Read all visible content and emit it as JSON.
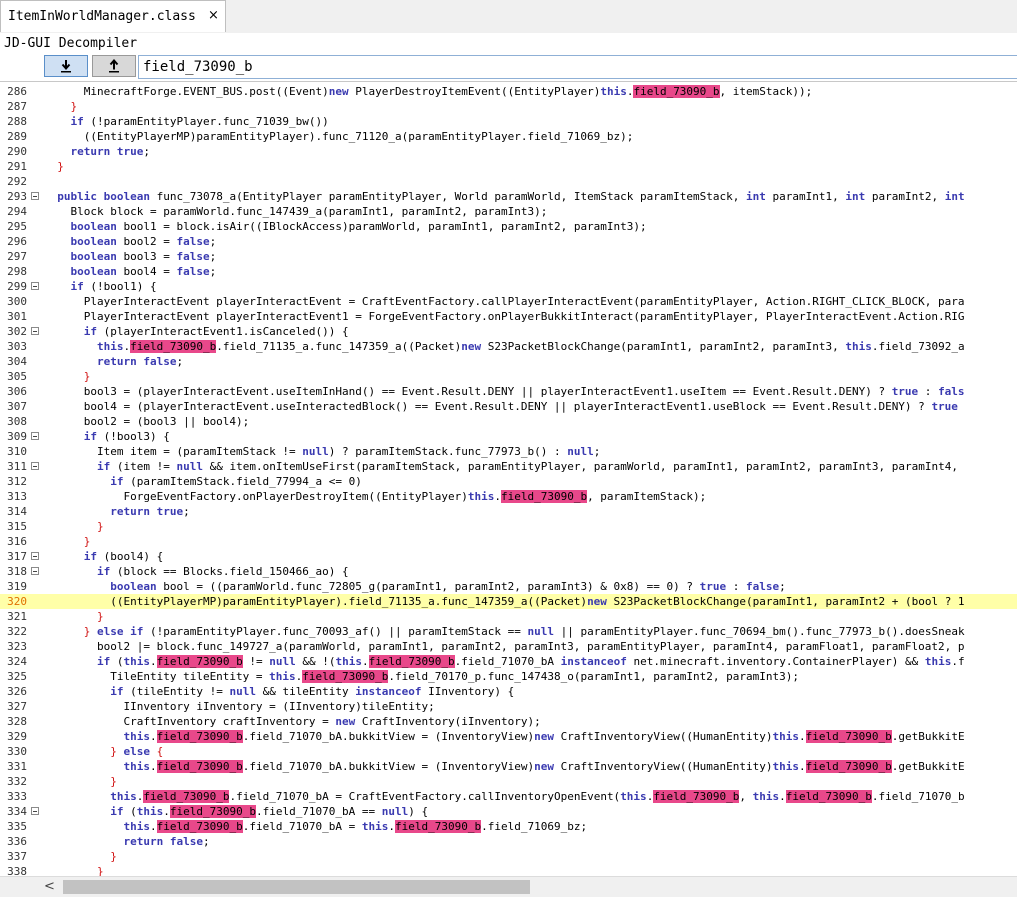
{
  "tab": {
    "label": "ItemInWorldManager.class",
    "close": "×"
  },
  "app_title": "JD-GUI Decompiler",
  "search": {
    "value": "field_73090_b",
    "down_icon": "arrow-down-icon",
    "up_icon": "arrow-up-icon"
  },
  "highlight_color": "#e8488a",
  "current_line_color": "#ffffa8",
  "current_line": 320,
  "scrollbar": {
    "left_arrow": "<"
  },
  "lines": [
    {
      "n": 286,
      "fold": false,
      "segs": [
        [
          "      MinecraftForge.EVENT_BUS.post((Event)",
          ""
        ],
        [
          "new",
          "k"
        ],
        [
          " PlayerDestroyItemEvent((EntityPlayer)",
          ""
        ],
        [
          "this",
          "k"
        ],
        [
          ".",
          ""
        ],
        [
          "field_73090_b",
          "h"
        ],
        [
          ", itemStack));",
          ""
        ]
      ]
    },
    {
      "n": 287,
      "fold": false,
      "segs": [
        [
          "    }",
          "r"
        ]
      ]
    },
    {
      "n": 288,
      "fold": false,
      "segs": [
        [
          "    ",
          ""
        ],
        [
          "if",
          "k"
        ],
        [
          " (!paramEntityPlayer.func_71039_bw())",
          ""
        ]
      ]
    },
    {
      "n": 289,
      "fold": false,
      "segs": [
        [
          "      ((EntityPlayerMP)paramEntityPlayer).func_71120_a(paramEntityPlayer.field_71069_bz);",
          ""
        ]
      ]
    },
    {
      "n": 290,
      "fold": false,
      "segs": [
        [
          "    ",
          ""
        ],
        [
          "return",
          "k"
        ],
        [
          " ",
          ""
        ],
        [
          "true",
          "k"
        ],
        [
          ";",
          ""
        ]
      ]
    },
    {
      "n": 291,
      "fold": false,
      "segs": [
        [
          "  }",
          "r"
        ]
      ]
    },
    {
      "n": 292,
      "fold": false,
      "segs": [
        [
          "",
          ""
        ]
      ]
    },
    {
      "n": 293,
      "fold": true,
      "segs": [
        [
          "  ",
          ""
        ],
        [
          "public",
          "k"
        ],
        [
          " ",
          ""
        ],
        [
          "boolean",
          "k"
        ],
        [
          " func_73078_a(EntityPlayer paramEntityPlayer, World paramWorld, ItemStack paramItemStack, ",
          ""
        ],
        [
          "int",
          "k"
        ],
        [
          " paramInt1, ",
          ""
        ],
        [
          "int",
          "k"
        ],
        [
          " paramInt2, ",
          ""
        ],
        [
          "int",
          "k"
        ]
      ]
    },
    {
      "n": 294,
      "fold": false,
      "segs": [
        [
          "    Block block = paramWorld.func_147439_a(paramInt1, paramInt2, paramInt3);",
          ""
        ]
      ]
    },
    {
      "n": 295,
      "fold": false,
      "segs": [
        [
          "    ",
          ""
        ],
        [
          "boolean",
          "k"
        ],
        [
          " bool1 = block.isAir((IBlockAccess)paramWorld, paramInt1, paramInt2, paramInt3);",
          ""
        ]
      ]
    },
    {
      "n": 296,
      "fold": false,
      "segs": [
        [
          "    ",
          ""
        ],
        [
          "boolean",
          "k"
        ],
        [
          " bool2 = ",
          ""
        ],
        [
          "false",
          "k"
        ],
        [
          ";",
          ""
        ]
      ]
    },
    {
      "n": 297,
      "fold": false,
      "segs": [
        [
          "    ",
          ""
        ],
        [
          "boolean",
          "k"
        ],
        [
          " bool3 = ",
          ""
        ],
        [
          "false",
          "k"
        ],
        [
          ";",
          ""
        ]
      ]
    },
    {
      "n": 298,
      "fold": false,
      "segs": [
        [
          "    ",
          ""
        ],
        [
          "boolean",
          "k"
        ],
        [
          " bool4 = ",
          ""
        ],
        [
          "false",
          "k"
        ],
        [
          ";",
          ""
        ]
      ]
    },
    {
      "n": 299,
      "fold": true,
      "segs": [
        [
          "    ",
          ""
        ],
        [
          "if",
          "k"
        ],
        [
          " (!bool1) {",
          ""
        ]
      ]
    },
    {
      "n": 300,
      "fold": false,
      "segs": [
        [
          "      PlayerInteractEvent playerInteractEvent = CraftEventFactory.callPlayerInteractEvent(paramEntityPlayer, Action.RIGHT_CLICK_BLOCK, para",
          ""
        ]
      ]
    },
    {
      "n": 301,
      "fold": false,
      "segs": [
        [
          "      PlayerInteractEvent playerInteractEvent1 = ForgeEventFactory.onPlayerBukkitInteract(paramEntityPlayer, PlayerInteractEvent.Action.RIG",
          ""
        ]
      ]
    },
    {
      "n": 302,
      "fold": true,
      "segs": [
        [
          "      ",
          ""
        ],
        [
          "if",
          "k"
        ],
        [
          " (playerInteractEvent1.isCanceled()) {",
          ""
        ]
      ]
    },
    {
      "n": 303,
      "fold": false,
      "segs": [
        [
          "        ",
          ""
        ],
        [
          "this",
          "k"
        ],
        [
          ".",
          ""
        ],
        [
          "field_73090_b",
          "h"
        ],
        [
          ".field_71135_a.func_147359_a((Packet)",
          ""
        ],
        [
          "new",
          "k"
        ],
        [
          " S23PacketBlockChange(paramInt1, paramInt2, paramInt3, ",
          ""
        ],
        [
          "this",
          "k"
        ],
        [
          ".field_73092_a",
          ""
        ]
      ]
    },
    {
      "n": 304,
      "fold": false,
      "segs": [
        [
          "        ",
          ""
        ],
        [
          "return",
          "k"
        ],
        [
          " ",
          ""
        ],
        [
          "false",
          "k"
        ],
        [
          ";",
          ""
        ]
      ]
    },
    {
      "n": 305,
      "fold": false,
      "segs": [
        [
          "      }",
          "r"
        ]
      ]
    },
    {
      "n": 306,
      "fold": false,
      "segs": [
        [
          "      bool3 = (playerInteractEvent.useItemInHand() == Event.Result.DENY || playerInteractEvent1.useItem == Event.Result.DENY) ? ",
          ""
        ],
        [
          "true",
          "k"
        ],
        [
          " : ",
          ""
        ],
        [
          "fals",
          "k"
        ]
      ]
    },
    {
      "n": 307,
      "fold": false,
      "segs": [
        [
          "      bool4 = (playerInteractEvent.useInteractedBlock() == Event.Result.DENY || playerInteractEvent1.useBlock == Event.Result.DENY) ? ",
          ""
        ],
        [
          "true",
          "k"
        ]
      ]
    },
    {
      "n": 308,
      "fold": false,
      "segs": [
        [
          "      bool2 = (bool3 || bool4);",
          ""
        ]
      ]
    },
    {
      "n": 309,
      "fold": true,
      "segs": [
        [
          "      ",
          ""
        ],
        [
          "if",
          "k"
        ],
        [
          " (!bool3) {",
          ""
        ]
      ]
    },
    {
      "n": 310,
      "fold": false,
      "segs": [
        [
          "        Item item = (paramItemStack != ",
          ""
        ],
        [
          "null",
          "k"
        ],
        [
          ") ? paramItemStack.func_77973_b() : ",
          ""
        ],
        [
          "null",
          "k"
        ],
        [
          ";",
          ""
        ]
      ]
    },
    {
      "n": 311,
      "fold": true,
      "segs": [
        [
          "        ",
          ""
        ],
        [
          "if",
          "k"
        ],
        [
          " (item != ",
          ""
        ],
        [
          "null",
          "k"
        ],
        [
          " && item.onItemUseFirst(paramItemStack, paramEntityPlayer, paramWorld, paramInt1, paramInt2, paramInt3, paramInt4,",
          ""
        ]
      ]
    },
    {
      "n": 312,
      "fold": false,
      "segs": [
        [
          "          ",
          ""
        ],
        [
          "if",
          "k"
        ],
        [
          " (paramItemStack.field_77994_a <= 0)",
          ""
        ]
      ]
    },
    {
      "n": 313,
      "fold": false,
      "segs": [
        [
          "            ForgeEventFactory.onPlayerDestroyItem((EntityPlayer)",
          ""
        ],
        [
          "this",
          "k"
        ],
        [
          ".",
          ""
        ],
        [
          "field_73090_b",
          "h"
        ],
        [
          ", paramItemStack);",
          ""
        ]
      ]
    },
    {
      "n": 314,
      "fold": false,
      "segs": [
        [
          "          ",
          ""
        ],
        [
          "return",
          "k"
        ],
        [
          " ",
          ""
        ],
        [
          "true",
          "k"
        ],
        [
          ";",
          ""
        ]
      ]
    },
    {
      "n": 315,
      "fold": false,
      "segs": [
        [
          "        }",
          "r"
        ]
      ]
    },
    {
      "n": 316,
      "fold": false,
      "segs": [
        [
          "      }",
          "r"
        ]
      ]
    },
    {
      "n": 317,
      "fold": true,
      "segs": [
        [
          "      ",
          ""
        ],
        [
          "if",
          "k"
        ],
        [
          " (bool4) {",
          ""
        ]
      ]
    },
    {
      "n": 318,
      "fold": true,
      "segs": [
        [
          "        ",
          ""
        ],
        [
          "if",
          "k"
        ],
        [
          " (block == Blocks.field_150466_ao) {",
          ""
        ]
      ]
    },
    {
      "n": 319,
      "fold": false,
      "segs": [
        [
          "          ",
          ""
        ],
        [
          "boolean",
          "k"
        ],
        [
          " bool = ((paramWorld.func_72805_g(paramInt1, paramInt2, paramInt3) & 0x8) == 0) ? ",
          ""
        ],
        [
          "true",
          "k"
        ],
        [
          " : ",
          ""
        ],
        [
          "false",
          "k"
        ],
        [
          ";",
          ""
        ]
      ]
    },
    {
      "n": 320,
      "fold": false,
      "segs": [
        [
          "          ((EntityPlayerMP)paramEntityPlayer).field_71135_a.func_147359_a((Packet)",
          ""
        ],
        [
          "new",
          "k"
        ],
        [
          " S23PacketBlockChange(paramInt1, paramInt2 + (bool ? 1",
          ""
        ]
      ]
    },
    {
      "n": 321,
      "fold": false,
      "segs": [
        [
          "        }",
          "r"
        ]
      ]
    },
    {
      "n": 322,
      "fold": false,
      "segs": [
        [
          "      } ",
          "r"
        ],
        [
          "else",
          "k"
        ],
        [
          " ",
          ""
        ],
        [
          "if",
          "k"
        ],
        [
          " (!paramEntityPlayer.func_70093_af() || paramItemStack == ",
          ""
        ],
        [
          "null",
          "k"
        ],
        [
          " || paramEntityPlayer.func_70694_bm().func_77973_b().doesSneak",
          ""
        ]
      ]
    },
    {
      "n": 323,
      "fold": false,
      "segs": [
        [
          "        bool2 |= block.func_149727_a(paramWorld, paramInt1, paramInt2, paramInt3, paramEntityPlayer, paramInt4, paramFloat1, paramFloat2, p",
          ""
        ]
      ]
    },
    {
      "n": 324,
      "fold": false,
      "segs": [
        [
          "        ",
          ""
        ],
        [
          "if",
          "k"
        ],
        [
          " (",
          ""
        ],
        [
          "this",
          "k"
        ],
        [
          ".",
          ""
        ],
        [
          "field_73090_b",
          "h"
        ],
        [
          " != ",
          ""
        ],
        [
          "null",
          "k"
        ],
        [
          " && !(",
          ""
        ],
        [
          "this",
          "k"
        ],
        [
          ".",
          ""
        ],
        [
          "field_73090_b",
          "h"
        ],
        [
          ".field_71070_bA ",
          ""
        ],
        [
          "instanceof",
          "k"
        ],
        [
          " net.minecraft.inventory.ContainerPlayer) && ",
          ""
        ],
        [
          "this",
          "k"
        ],
        [
          ".f",
          ""
        ]
      ]
    },
    {
      "n": 325,
      "fold": false,
      "segs": [
        [
          "          TileEntity tileEntity = ",
          ""
        ],
        [
          "this",
          "k"
        ],
        [
          ".",
          ""
        ],
        [
          "field_73090_b",
          "h"
        ],
        [
          ".field_70170_p.func_147438_o(paramInt1, paramInt2, paramInt3);",
          ""
        ]
      ]
    },
    {
      "n": 326,
      "fold": false,
      "segs": [
        [
          "          ",
          ""
        ],
        [
          "if",
          "k"
        ],
        [
          " (tileEntity != ",
          ""
        ],
        [
          "null",
          "k"
        ],
        [
          " && tileEntity ",
          ""
        ],
        [
          "instanceof",
          "k"
        ],
        [
          " IInventory) {",
          ""
        ]
      ]
    },
    {
      "n": 327,
      "fold": false,
      "segs": [
        [
          "            IInventory iInventory = (IInventory)tileEntity;",
          ""
        ]
      ]
    },
    {
      "n": 328,
      "fold": false,
      "segs": [
        [
          "            CraftInventory craftInventory = ",
          ""
        ],
        [
          "new",
          "k"
        ],
        [
          " CraftInventory(iInventory);",
          ""
        ]
      ]
    },
    {
      "n": 329,
      "fold": false,
      "segs": [
        [
          "            ",
          ""
        ],
        [
          "this",
          "k"
        ],
        [
          ".",
          ""
        ],
        [
          "field_73090_b",
          "h"
        ],
        [
          ".field_71070_bA.bukkitView = (InventoryView)",
          ""
        ],
        [
          "new",
          "k"
        ],
        [
          " CraftInventoryView((HumanEntity)",
          ""
        ],
        [
          "this",
          "k"
        ],
        [
          ".",
          ""
        ],
        [
          "field_73090_b",
          "h"
        ],
        [
          ".getBukkitE",
          ""
        ]
      ]
    },
    {
      "n": 330,
      "fold": false,
      "segs": [
        [
          "          } ",
          "r"
        ],
        [
          "else",
          "k"
        ],
        [
          " {",
          "r"
        ]
      ]
    },
    {
      "n": 331,
      "fold": false,
      "segs": [
        [
          "            ",
          ""
        ],
        [
          "this",
          "k"
        ],
        [
          ".",
          ""
        ],
        [
          "field_73090_b",
          "h"
        ],
        [
          ".field_71070_bA.bukkitView = (InventoryView)",
          ""
        ],
        [
          "new",
          "k"
        ],
        [
          " CraftInventoryView((HumanEntity)",
          ""
        ],
        [
          "this",
          "k"
        ],
        [
          ".",
          ""
        ],
        [
          "field_73090_b",
          "h"
        ],
        [
          ".getBukkitE",
          ""
        ]
      ]
    },
    {
      "n": 332,
      "fold": false,
      "segs": [
        [
          "          }",
          "r"
        ]
      ]
    },
    {
      "n": 333,
      "fold": false,
      "segs": [
        [
          "          ",
          ""
        ],
        [
          "this",
          "k"
        ],
        [
          ".",
          ""
        ],
        [
          "field_73090_b",
          "h"
        ],
        [
          ".field_71070_bA = CraftEventFactory.callInventoryOpenEvent(",
          ""
        ],
        [
          "this",
          "k"
        ],
        [
          ".",
          ""
        ],
        [
          "field_73090_b",
          "h"
        ],
        [
          ", ",
          ""
        ],
        [
          "this",
          "k"
        ],
        [
          ".",
          ""
        ],
        [
          "field_73090_b",
          "h"
        ],
        [
          ".field_71070_b",
          ""
        ]
      ]
    },
    {
      "n": 334,
      "fold": true,
      "segs": [
        [
          "          ",
          ""
        ],
        [
          "if",
          "k"
        ],
        [
          " (",
          ""
        ],
        [
          "this",
          "k"
        ],
        [
          ".",
          ""
        ],
        [
          "field_73090_b",
          "h"
        ],
        [
          ".field_71070_bA == ",
          ""
        ],
        [
          "null",
          "k"
        ],
        [
          ") {",
          ""
        ]
      ]
    },
    {
      "n": 335,
      "fold": false,
      "segs": [
        [
          "            ",
          ""
        ],
        [
          "this",
          "k"
        ],
        [
          ".",
          ""
        ],
        [
          "field_73090_b",
          "h"
        ],
        [
          ".field_71070_bA = ",
          ""
        ],
        [
          "this",
          "k"
        ],
        [
          ".",
          ""
        ],
        [
          "field_73090_b",
          "h"
        ],
        [
          ".field_71069_bz;",
          ""
        ]
      ]
    },
    {
      "n": 336,
      "fold": false,
      "segs": [
        [
          "            ",
          ""
        ],
        [
          "return",
          "k"
        ],
        [
          " ",
          ""
        ],
        [
          "false",
          "k"
        ],
        [
          ";",
          ""
        ]
      ]
    },
    {
      "n": 337,
      "fold": false,
      "segs": [
        [
          "          }",
          "r"
        ]
      ]
    },
    {
      "n": 338,
      "fold": false,
      "segs": [
        [
          "        }",
          "r"
        ]
      ]
    }
  ]
}
